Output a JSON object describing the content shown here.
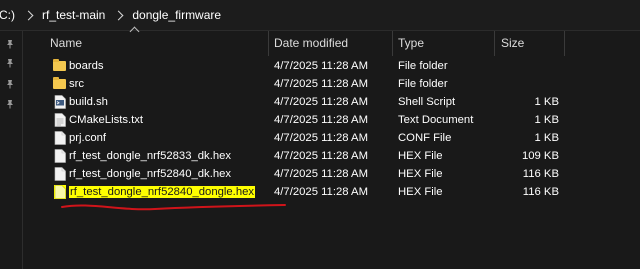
{
  "address": {
    "crumbs": [
      "C:)",
      "rf_test-main",
      "dongle_firmware"
    ]
  },
  "header": {
    "name": "Name",
    "date": "Date modified",
    "type": "Type",
    "size": "Size"
  },
  "files": [
    {
      "name": "boards",
      "date": "4/7/2025 11:28 AM",
      "type": "File folder",
      "size": "",
      "icon": "folder-icon"
    },
    {
      "name": "src",
      "date": "4/7/2025 11:28 AM",
      "type": "File folder",
      "size": "",
      "icon": "folder-icon"
    },
    {
      "name": "build.sh",
      "date": "4/7/2025 11:28 AM",
      "type": "Shell Script",
      "size": "1 KB",
      "icon": "shell-script-icon"
    },
    {
      "name": "CMakeLists.txt",
      "date": "4/7/2025 11:28 AM",
      "type": "Text Document",
      "size": "1 KB",
      "icon": "text-file-icon"
    },
    {
      "name": "prj.conf",
      "date": "4/7/2025 11:28 AM",
      "type": "CONF File",
      "size": "1 KB",
      "icon": "file-icon"
    },
    {
      "name": "rf_test_dongle_nrf52833_dk.hex",
      "date": "4/7/2025 11:28 AM",
      "type": "HEX File",
      "size": "109 KB",
      "icon": "file-icon"
    },
    {
      "name": "rf_test_dongle_nrf52840_dk.hex",
      "date": "4/7/2025 11:28 AM",
      "type": "HEX File",
      "size": "116 KB",
      "icon": "file-icon"
    },
    {
      "name": "rf_test_dongle_nrf52840_dongle.hex",
      "date": "4/7/2025 11:28 AM",
      "type": "HEX File",
      "size": "116 KB",
      "icon": "file-icon"
    }
  ],
  "colors": {
    "background": "#191919",
    "folder": "#f4c84f",
    "highlight": "#ffff00",
    "annotation": "#d0141a"
  }
}
